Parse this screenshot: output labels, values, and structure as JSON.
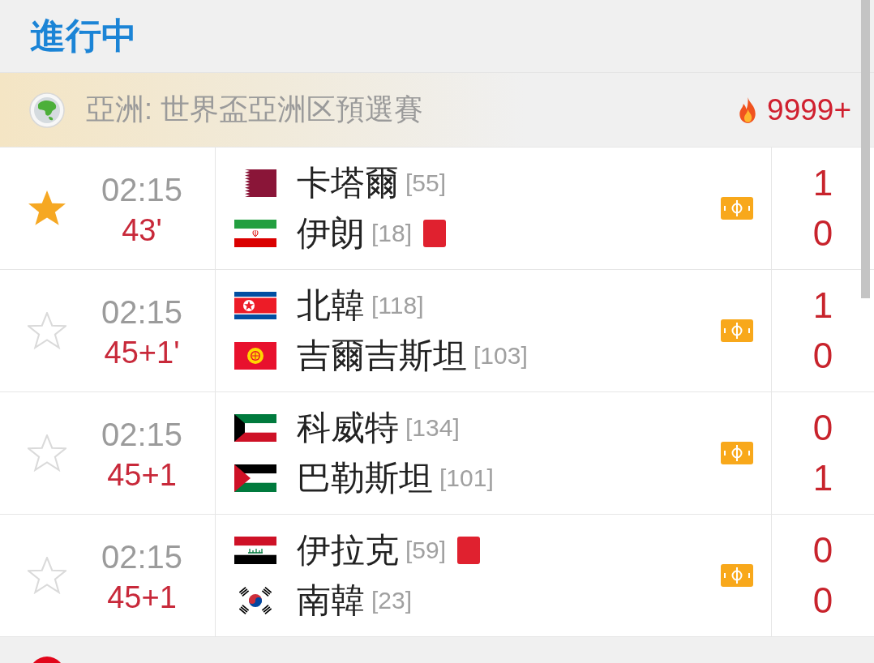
{
  "section": {
    "title": "進行中"
  },
  "leagues": [
    {
      "name": "亞洲: 世界盃亞洲区預選賽",
      "hot": "9999+",
      "matches": [
        {
          "favorite": true,
          "time": "02:15",
          "minute": "43'",
          "teams": [
            {
              "name": "卡塔爾",
              "rank": "[55]",
              "red_card": false,
              "score": "1"
            },
            {
              "name": "伊朗",
              "rank": "[18]",
              "red_card": true,
              "score": "0"
            }
          ]
        },
        {
          "favorite": false,
          "time": "02:15",
          "minute": "45+1'",
          "teams": [
            {
              "name": "北韓",
              "rank": "[118]",
              "red_card": false,
              "score": "1"
            },
            {
              "name": "吉爾吉斯坦",
              "rank": "[103]",
              "red_card": false,
              "score": "0"
            }
          ]
        },
        {
          "favorite": false,
          "time": "02:15",
          "minute": "45+1",
          "teams": [
            {
              "name": "科威特",
              "rank": "[134]",
              "red_card": false,
              "score": "0"
            },
            {
              "name": "巴勒斯坦",
              "rank": "[101]",
              "red_card": false,
              "score": "1"
            }
          ]
        },
        {
          "favorite": false,
          "time": "02:15",
          "minute": "45+1",
          "teams": [
            {
              "name": "伊拉克",
              "rank": "[59]",
              "red_card": true,
              "score": "0"
            },
            {
              "name": "南韓",
              "rank": "[23]",
              "red_card": false,
              "score": "0"
            }
          ]
        }
      ]
    },
    {
      "color": "#e2061b"
    }
  ]
}
